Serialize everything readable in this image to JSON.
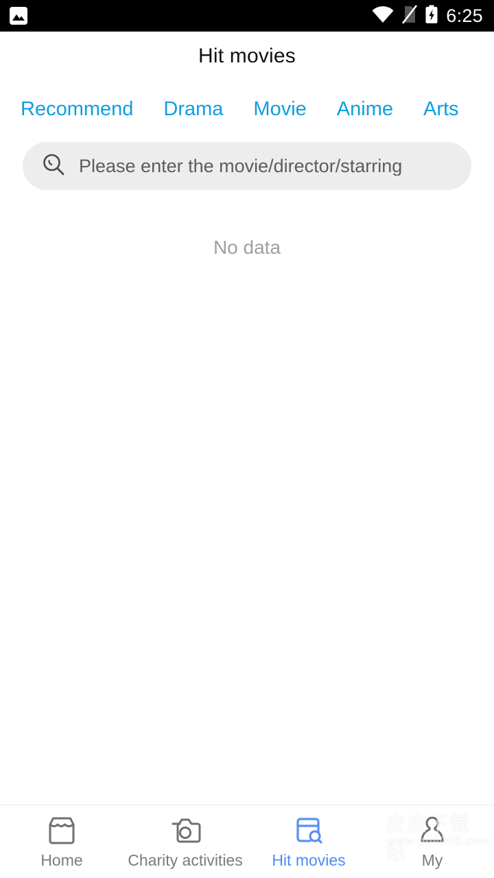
{
  "status_bar": {
    "notification_icon": "photo-icon",
    "wifi_icon": "wifi-icon",
    "sim_icon": "no-sim-card-icon",
    "battery_icon": "battery-charging-icon",
    "time": "6:25",
    "background_color": "#000000",
    "foreground_color": "#ffffff"
  },
  "header": {
    "title": "Hit movies"
  },
  "tabs": {
    "accent_color": "#0d9ee0",
    "items": [
      {
        "label": "Recommend"
      },
      {
        "label": "Drama"
      },
      {
        "label": "Movie"
      },
      {
        "label": "Anime"
      },
      {
        "label": "Arts"
      }
    ]
  },
  "search": {
    "icon": "search-icon",
    "value": "",
    "placeholder": "Please enter the movie/director/starring",
    "background_color": "#ededed"
  },
  "content": {
    "empty_text": "No data",
    "empty_text_color": "#a0a0a0"
  },
  "bottom_nav": {
    "active_color": "#4a8cf7",
    "inactive_color": "#7b7b7b",
    "items": [
      {
        "label": "Home",
        "icon": "store-icon"
      },
      {
        "label": "Charity activities",
        "icon": "camera-icon"
      },
      {
        "label": "Hit movies",
        "icon": "window-search-icon"
      },
      {
        "label": "My",
        "icon": "person-icon"
      }
    ]
  },
  "watermark": {
    "logo": "pp-logo-icon",
    "text_cn": "皮皮下载站",
    "url": "www.pp4000.com"
  }
}
